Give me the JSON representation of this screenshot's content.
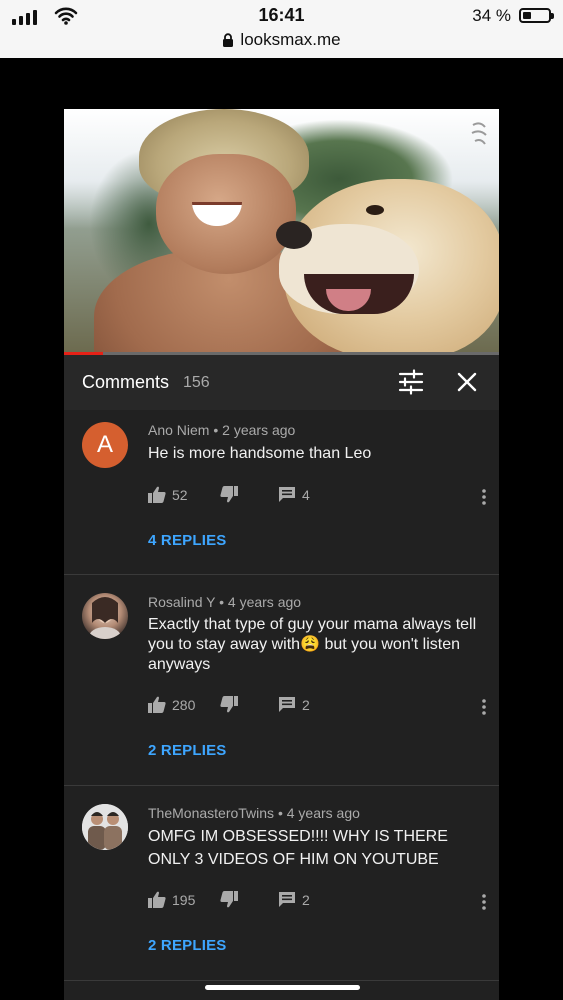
{
  "status_bar": {
    "time": "16:41",
    "url": "looksmax.me",
    "battery_text": "34 %",
    "battery_level": 0.34,
    "icons": [
      "signal-icon",
      "wifi-icon",
      "lock-icon",
      "battery-icon"
    ]
  },
  "video": {
    "progress_fraction": 0.09
  },
  "comments_panel": {
    "title": "Comments",
    "count": "156",
    "filter_icon": "sliders-icon",
    "close_icon": "close-icon"
  },
  "comments": [
    {
      "author": "Ano Niem",
      "age": "2 years ago",
      "meta_separator": "•",
      "avatar_letter": "A",
      "text": "He is more handsome than Leo",
      "likes": "52",
      "reply_count": "4",
      "replies_label": "4 REPLIES"
    },
    {
      "author": "Rosalind Y",
      "age": "4 years ago",
      "meta_separator": "•",
      "text": "Exactly that type of guy your mama always tell you to stay away with😩 but you won't listen anyways",
      "likes": "280",
      "reply_count": "2",
      "replies_label": "2 REPLIES"
    },
    {
      "author": "TheMonasteroTwins",
      "age": "4 years ago",
      "meta_separator": "•",
      "text": "OMFG IM OBSESSED!!!! WHY IS THERE ONLY 3 VIDEOS OF HIM ON YOUTUBE",
      "likes": "195",
      "reply_count": "2",
      "replies_label": "2 REPLIES"
    }
  ],
  "colors": {
    "accent_link": "#3ea6ff",
    "panel_bg": "#212121",
    "header_bg": "#282828",
    "progress_played": "#e62117",
    "avatar_a": "#d55f2f"
  }
}
